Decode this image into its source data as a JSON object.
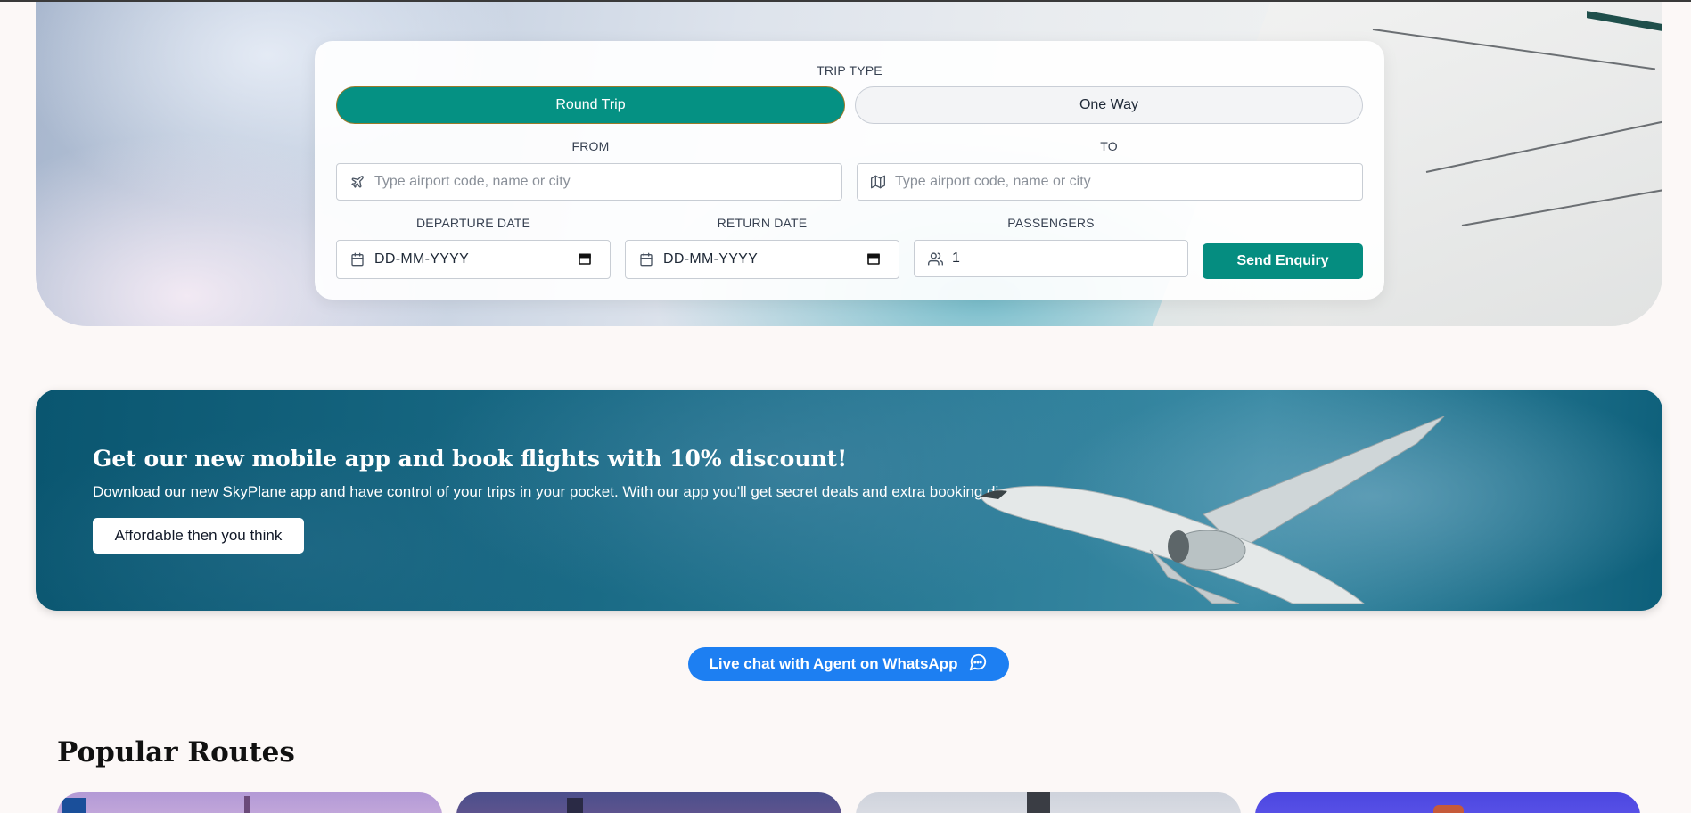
{
  "search_form": {
    "trip_type_label": "TRIP TYPE",
    "trip_types": [
      "Round Trip",
      "One Way"
    ],
    "selected_trip_type": "Round Trip",
    "from_label": "FROM",
    "from_placeholder": "Type airport code, name or city",
    "to_label": "TO",
    "to_placeholder": "Type airport code, name or city",
    "departure_label": "DEPARTURE DATE",
    "departure_value": "DD-MM-YYYY",
    "return_label": "RETURN DATE",
    "return_value": "DD-MM-YYYY",
    "passengers_label": "PASSENGERS",
    "passengers_value": "1",
    "submit_label": "Send Enquiry"
  },
  "promo": {
    "title": "Get our new mobile app and book flights with 10% discount!",
    "subtitle": "Download our new SkyPlane app and have control of your trips in your pocket. With our app you'll get secret deals and extra booking discounts.",
    "button_label": "Affordable then you think"
  },
  "chat": {
    "label": "Live chat with Agent on WhatsApp"
  },
  "routes": {
    "title": "Popular Routes"
  },
  "colors": {
    "accent": "#059183",
    "chat": "#1d7ff2",
    "promo_bg": "#0d5f7a"
  },
  "icons": {
    "from": "plane-icon",
    "to": "map-icon",
    "date": "calendar-icon",
    "passengers": "users-icon",
    "chat": "chat-bubble-icon"
  }
}
